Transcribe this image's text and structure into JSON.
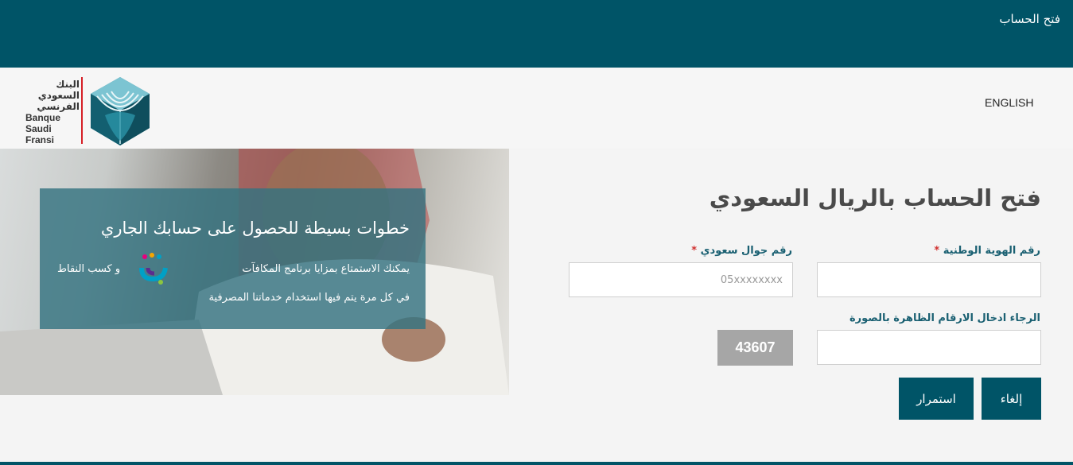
{
  "topbar": {
    "title": "فتح الحساب"
  },
  "header": {
    "logo": {
      "text_ar": [
        "البنك",
        "السعودي",
        "الفرنسي"
      ],
      "text_en": [
        "Banque",
        "Saudi",
        "Fransi"
      ]
    },
    "language_link": "ENGLISH"
  },
  "hero": {
    "heading": "خطوات بسيطة للحصول على حسابك الجاري",
    "line1_right": "يمكنك الاستمتاع بمزايا برنامج المكافآت",
    "line1_left": "و كسب النقاط",
    "line2": "في كل مرة يتم فيها استخدام خدماتنا المصرفية",
    "rewards_logo": "جَنى"
  },
  "form": {
    "title": "فتح الحساب بالريال السعودي",
    "national_id": {
      "label": "رقم الهوية الوطنية",
      "required_mark": "*",
      "value": "",
      "placeholder": ""
    },
    "mobile": {
      "label": "رقم جوال سعودي",
      "required_mark": "*",
      "value": "",
      "placeholder": "05xxxxxxxx"
    },
    "captcha": {
      "label": "الرجاء ادخال الارقام الظاهرة بالصورة",
      "code": "43607",
      "value": "",
      "placeholder": ""
    },
    "buttons": {
      "cancel": "إلغاء",
      "continue": "استمرار"
    }
  },
  "colors": {
    "primary": "#005467",
    "label": "#1a6072",
    "required": "#d0302f",
    "captcha_bg": "#a6a6a6"
  }
}
